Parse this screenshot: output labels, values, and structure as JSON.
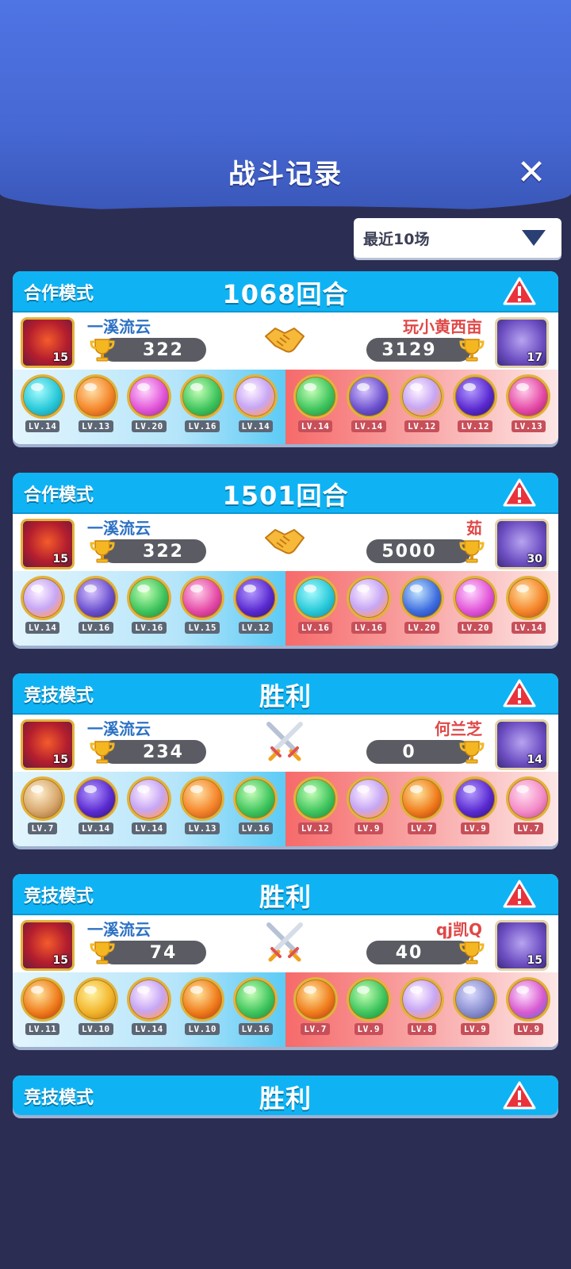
{
  "header": {
    "title": "战斗记录"
  },
  "filter": {
    "label": "最近10场"
  },
  "colors": {
    "accent": "#0fb3f4",
    "score_bg": "#5b5c63",
    "left_name": "#2d72c4",
    "right_name": "#e04848"
  },
  "records": [
    {
      "mode": "合作模式",
      "result": "1068回合",
      "vs_icon": "handshake-icon",
      "left": {
        "name": "一溪流云",
        "score": "322",
        "level": "15",
        "pets": [
          {
            "lv": "LV.14",
            "orb": "o-cyan"
          },
          {
            "lv": "LV.13",
            "orb": "o-orange"
          },
          {
            "lv": "LV.20",
            "orb": "o-pink"
          },
          {
            "lv": "LV.16",
            "orb": "o-green"
          },
          {
            "lv": "LV.14",
            "orb": "o-rainbow"
          }
        ]
      },
      "right": {
        "name": "玩小黄西亩",
        "score": "3129",
        "level": "17",
        "pets": [
          {
            "lv": "LV.14",
            "orb": "o-green"
          },
          {
            "lv": "LV.14",
            "orb": "o-purple"
          },
          {
            "lv": "LV.12",
            "orb": "o-rainbow"
          },
          {
            "lv": "LV.12",
            "orb": "o-violet"
          },
          {
            "lv": "LV.13",
            "orb": "o-magenta"
          }
        ]
      }
    },
    {
      "mode": "合作模式",
      "result": "1501回合",
      "vs_icon": "handshake-icon",
      "left": {
        "name": "一溪流云",
        "score": "322",
        "level": "15",
        "pets": [
          {
            "lv": "LV.14",
            "orb": "o-rainbow"
          },
          {
            "lv": "LV.16",
            "orb": "o-purple"
          },
          {
            "lv": "LV.16",
            "orb": "o-green"
          },
          {
            "lv": "LV.15",
            "orb": "o-magenta"
          },
          {
            "lv": "LV.12",
            "orb": "o-violet"
          }
        ]
      },
      "right": {
        "name": "茹",
        "score": "5000",
        "level": "30",
        "pets": [
          {
            "lv": "LV.16",
            "orb": "o-cyan"
          },
          {
            "lv": "LV.16",
            "orb": "o-rainbow"
          },
          {
            "lv": "LV.20",
            "orb": "o-blue"
          },
          {
            "lv": "LV.20",
            "orb": "o-pink"
          },
          {
            "lv": "LV.14",
            "orb": "o-orange"
          }
        ]
      }
    },
    {
      "mode": "竞技模式",
      "result": "胜利",
      "vs_icon": "crossed-swords-icon",
      "left": {
        "name": "一溪流云",
        "score": "234",
        "level": "15",
        "pets": [
          {
            "lv": "LV.7",
            "orb": "o-face"
          },
          {
            "lv": "LV.14",
            "orb": "o-violet"
          },
          {
            "lv": "LV.14",
            "orb": "o-rainbow"
          },
          {
            "lv": "LV.13",
            "orb": "o-orange"
          },
          {
            "lv": "LV.16",
            "orb": "o-green"
          }
        ]
      },
      "right": {
        "name": "何兰芝",
        "score": "0",
        "level": "14",
        "pets": [
          {
            "lv": "LV.12",
            "orb": "o-green"
          },
          {
            "lv": "LV.9",
            "orb": "o-rainbow"
          },
          {
            "lv": "LV.7",
            "orb": "o-fire"
          },
          {
            "lv": "LV.9",
            "orb": "o-violet"
          },
          {
            "lv": "LV.7",
            "orb": "o-heart"
          }
        ]
      }
    },
    {
      "mode": "竞技模式",
      "result": "胜利",
      "vs_icon": "crossed-swords-icon",
      "left": {
        "name": "一溪流云",
        "score": "74",
        "level": "15",
        "pets": [
          {
            "lv": "LV.11",
            "orb": "o-fire"
          },
          {
            "lv": "LV.10",
            "orb": "o-gold"
          },
          {
            "lv": "LV.14",
            "orb": "o-rainbow"
          },
          {
            "lv": "LV.10",
            "orb": "o-fire"
          },
          {
            "lv": "LV.16",
            "orb": "o-green"
          }
        ]
      },
      "right": {
        "name": "qj凯Q",
        "score": "40",
        "level": "15",
        "pets": [
          {
            "lv": "LV.7",
            "orb": "o-fire"
          },
          {
            "lv": "LV.9",
            "orb": "o-green"
          },
          {
            "lv": "LV.8",
            "orb": "o-rainbow"
          },
          {
            "lv": "LV.9",
            "orb": "o-grey"
          },
          {
            "lv": "LV.9",
            "orb": "o-star"
          }
        ]
      }
    }
  ],
  "partial_record": {
    "mode": "竞技模式",
    "result": "胜利"
  }
}
